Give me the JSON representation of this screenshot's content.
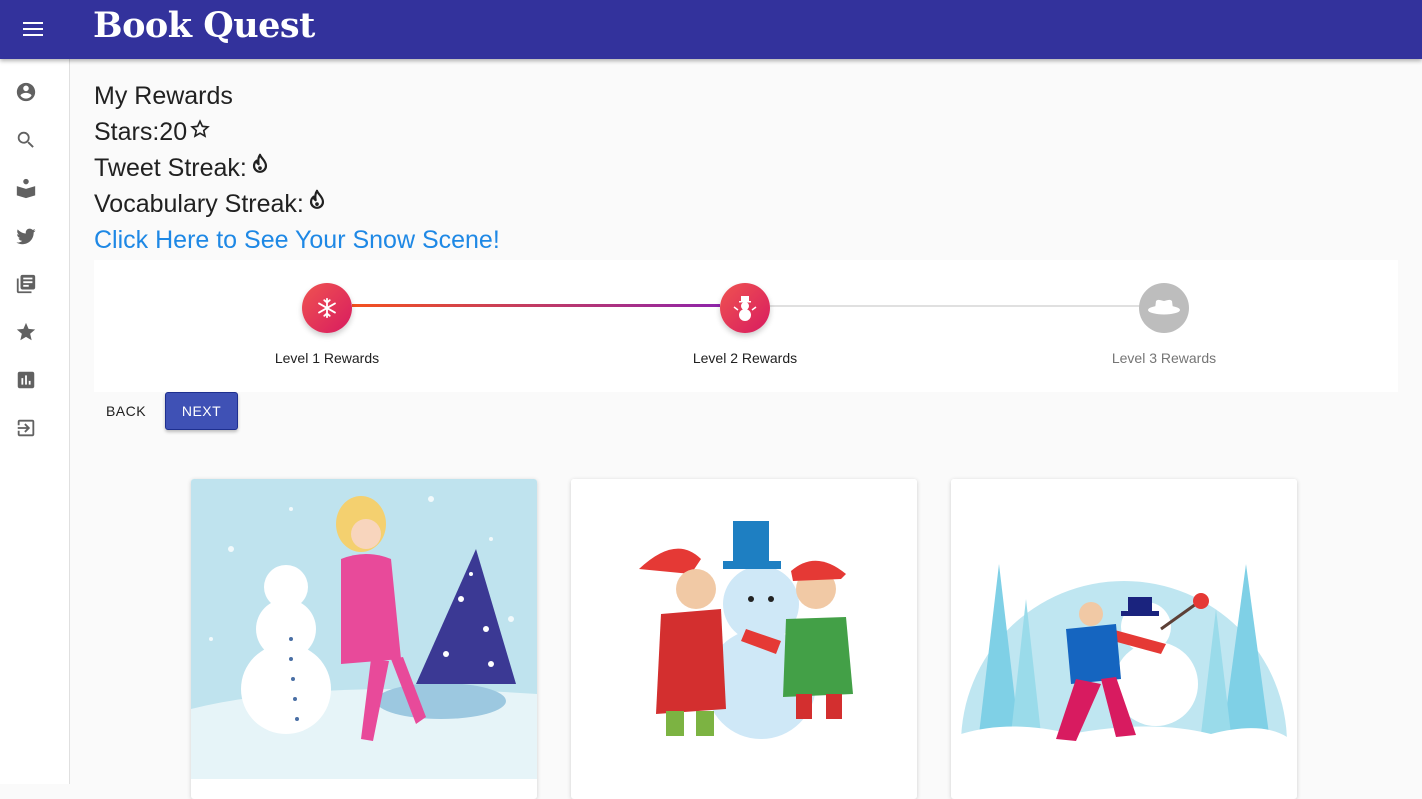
{
  "app": {
    "title": "Book Quest"
  },
  "nav": [
    {
      "icon": "account-circle-icon",
      "label": "Profile"
    },
    {
      "icon": "search-icon",
      "label": "Search"
    },
    {
      "icon": "book-reader-icon",
      "label": "Reading"
    },
    {
      "icon": "twitter-icon",
      "label": "Tweets"
    },
    {
      "icon": "library-books-icon",
      "label": "Vocabulary"
    },
    {
      "icon": "star-icon",
      "label": "Rewards"
    },
    {
      "icon": "bar-chart-icon",
      "label": "Stats"
    },
    {
      "icon": "logout-icon",
      "label": "Logout"
    }
  ],
  "rewards": {
    "heading": "My Rewards",
    "stars_label": "Stars: ",
    "stars_value": "20",
    "tweet_streak_label": "Tweet Streak: ",
    "vocab_streak_label": "Vocabulary Streak: ",
    "snow_scene_link": "Click Here to See Your Snow Scene!"
  },
  "stepper": {
    "steps": [
      {
        "label": "Level 1 Rewards",
        "icon": "snowflake-icon",
        "state": "completed"
      },
      {
        "label": "Level 2 Rewards",
        "icon": "snowman-icon",
        "state": "active"
      },
      {
        "label": "Level 3 Rewards",
        "icon": "hat-icon",
        "state": "inactive"
      }
    ]
  },
  "buttons": {
    "back": "BACK",
    "next": "NEXT"
  },
  "cards": [
    {
      "image": "girl-skating-snowman-illustration"
    },
    {
      "image": "kids-building-snowman-illustration"
    },
    {
      "image": "man-building-snowman-illustration"
    }
  ],
  "colors": {
    "appbar": "#33329c",
    "link": "#1e88e5",
    "primary_button": "#3f51b5",
    "step_gradient_start": "#f4511e",
    "step_gradient_end": "#8e24aa"
  }
}
